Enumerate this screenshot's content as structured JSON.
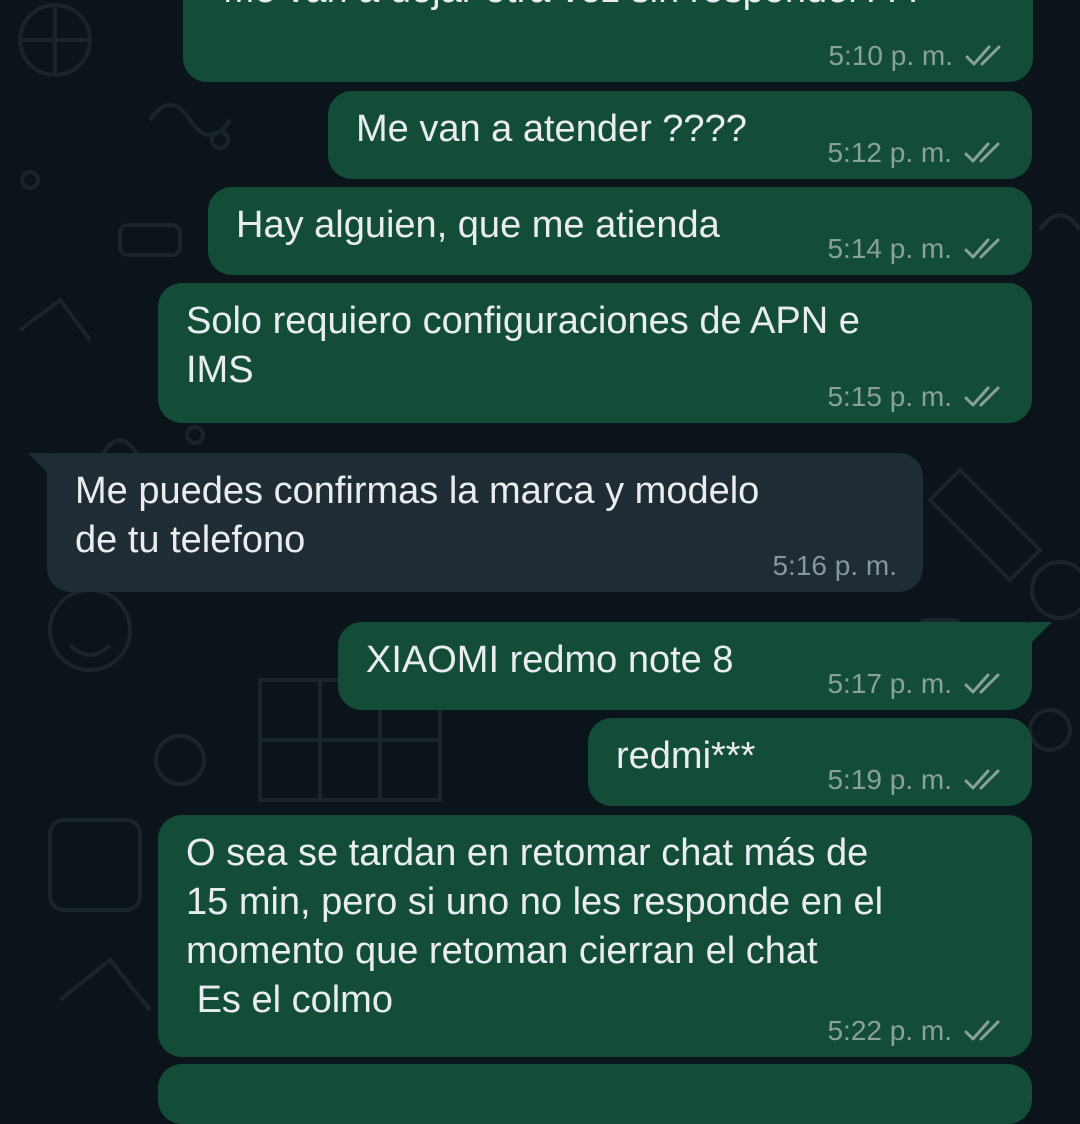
{
  "colors": {
    "background": "#0b141a",
    "outgoing_bubble": "#134d37",
    "incoming_bubble": "#1f2c34",
    "text": "#e9edef",
    "timestamp": "#8aa197"
  },
  "messages": [
    {
      "direction": "out",
      "text": "Me van a dejar otra vez sin responder???",
      "time": "5:10 p. m.",
      "status": "read-ticks-icon"
    },
    {
      "direction": "out",
      "text": "Me van a atender ????",
      "time": "5:12 p. m.",
      "status": "read-ticks-icon"
    },
    {
      "direction": "out",
      "text": "Hay alguien, que me atienda",
      "time": "5:14 p. m.",
      "status": "read-ticks-icon"
    },
    {
      "direction": "out",
      "text": "Solo requiero configuraciones de APN e\nIMS",
      "time": "5:15 p. m.",
      "status": "read-ticks-icon"
    },
    {
      "direction": "in",
      "text": "Me puedes confirmas la marca y modelo\nde tu telefono",
      "time": "5:16 p. m."
    },
    {
      "direction": "out",
      "text": "XIAOMI redmo note 8",
      "time": "5:17 p. m.",
      "status": "read-ticks-icon"
    },
    {
      "direction": "out",
      "text": "redmi***",
      "time": "5:19 p. m.",
      "status": "read-ticks-icon"
    },
    {
      "direction": "out",
      "text": "O sea se tardan en retomar chat más de\n15 min, pero si uno no les responde en el\nmomento que retoman cierran el chat\n Es el colmo",
      "time": "5:22 p. m.",
      "status": "read-ticks-icon"
    }
  ]
}
